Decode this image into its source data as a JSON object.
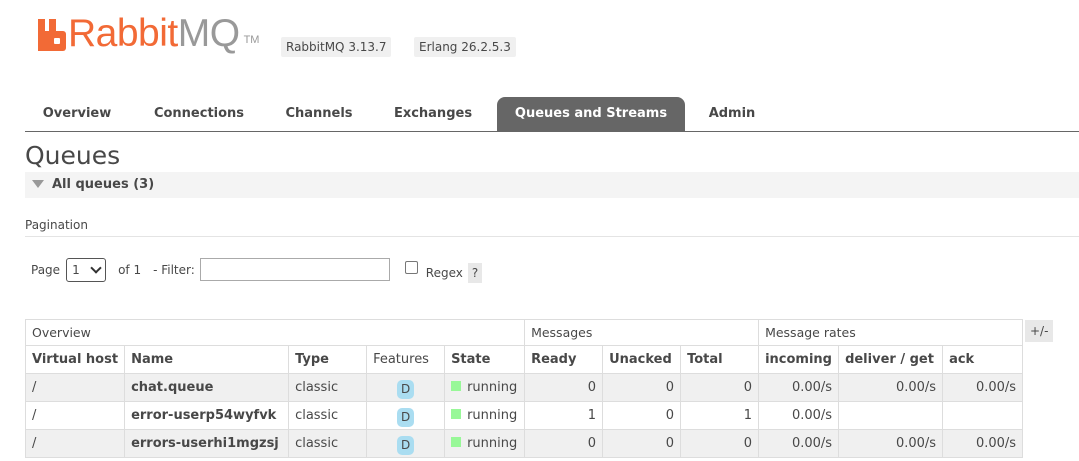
{
  "header": {
    "brand_primary": "Rabbit",
    "brand_secondary": "MQ",
    "trademark": "TM",
    "rabbitmq_version": "RabbitMQ 3.13.7",
    "erlang_version": "Erlang 26.2.5.3",
    "brand_color": "#f26a36"
  },
  "nav": {
    "tabs": [
      {
        "label": "Overview"
      },
      {
        "label": "Connections"
      },
      {
        "label": "Channels"
      },
      {
        "label": "Exchanges"
      },
      {
        "label": "Queues and Streams",
        "active": true
      },
      {
        "label": "Admin"
      }
    ]
  },
  "page": {
    "title": "Queues",
    "section_label": "All queues (3)"
  },
  "pagination": {
    "label": "Pagination",
    "page_label": "Page",
    "page_value": "1",
    "of_label": "of 1",
    "filter_label": "- Filter:",
    "filter_value": "",
    "regex_label": "Regex",
    "regex_checked": false,
    "help_label": "?"
  },
  "table": {
    "groups": [
      "Overview",
      "Messages",
      "Message rates"
    ],
    "toggle_label": "+/-",
    "columns": [
      "Virtual host",
      "Name",
      "Type",
      "Features",
      "State",
      "Ready",
      "Unacked",
      "Total",
      "incoming",
      "deliver / get",
      "ack"
    ],
    "rows": [
      {
        "vhost": "/",
        "name": "chat.queue",
        "type": "classic",
        "features": "D",
        "state": "running",
        "ready": "0",
        "unacked": "0",
        "total": "0",
        "incoming": "0.00/s",
        "deliver_get": "0.00/s",
        "ack": "0.00/s"
      },
      {
        "vhost": "/",
        "name": "error-userp54wyfvk",
        "type": "classic",
        "features": "D",
        "state": "running",
        "ready": "1",
        "unacked": "0",
        "total": "1",
        "incoming": "0.00/s",
        "deliver_get": "",
        "ack": ""
      },
      {
        "vhost": "/",
        "name": "errors-userhi1mgzsj",
        "type": "classic",
        "features": "D",
        "state": "running",
        "ready": "0",
        "unacked": "0",
        "total": "0",
        "incoming": "0.00/s",
        "deliver_get": "0.00/s",
        "ack": "0.00/s"
      }
    ]
  }
}
